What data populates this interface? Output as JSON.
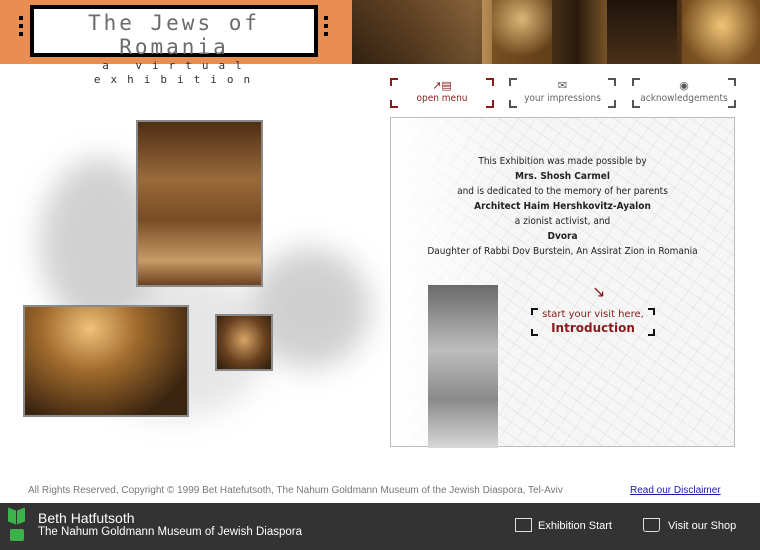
{
  "header": {
    "title": "The Jews of Romania",
    "subtitle": "a virtual exhibition"
  },
  "nav": [
    {
      "label": "open menu",
      "icon": "menu-icon"
    },
    {
      "label": "your impressions",
      "icon": "envelope-icon"
    },
    {
      "label": "acknowledgements",
      "icon": "globe-icon"
    }
  ],
  "dedication": {
    "line1": "This Exhibition was made possible by",
    "name1": "Mrs. Shosh Carmel",
    "line2": "and is dedicated to the memory of her parents",
    "name2": "Architect Haim Hershkovitz-Ayalon",
    "line3": "a zionist activist, and",
    "name3": "Dvora",
    "line4": "Daughter of Rabbi Dov Burstein, An Assirat Zion in Romania"
  },
  "start": {
    "line1": "start your visit here,",
    "line2": "Introduction"
  },
  "footer": {
    "rights": "All Rights Reserved,  Copyright © 1999  Bet Hatefutsoth, The Nahum Goldmann Museum of the Jewish Diaspora, Tel-Aviv",
    "disclaimer": "Read our Disclaimer"
  },
  "bar": {
    "title": "Beth Hatfutsoth",
    "subtitle": "The Nahum Goldmann Museum of Jewish Diaspora",
    "exhibition_start": "Exhibition Start",
    "shop": "Visit our Shop"
  },
  "colors": {
    "header_orange": "#e88e52",
    "accent_red": "#8b1a1a",
    "bar_gray": "#333333",
    "logo_green": "#3cb34a",
    "link_blue": "#1a1aa8"
  }
}
